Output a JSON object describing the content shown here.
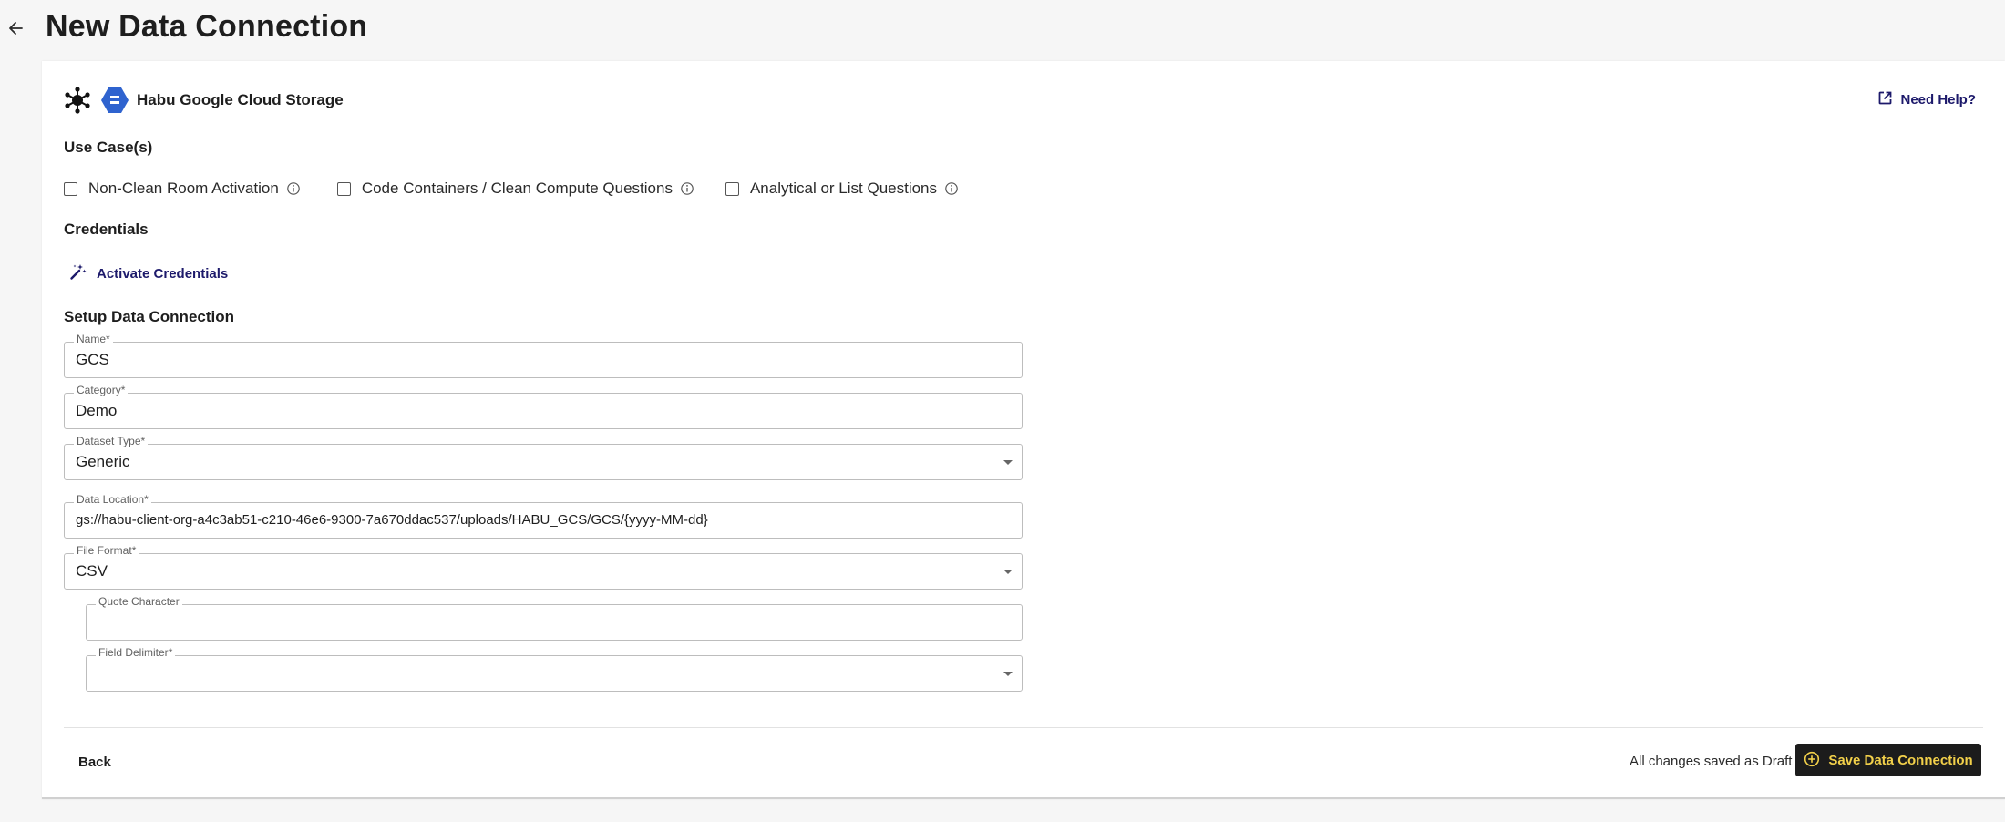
{
  "header": {
    "back_icon": "arrow-left-icon",
    "title": "New Data Connection"
  },
  "provider": {
    "icon_a": "habu-network-icon",
    "icon_b": "gcs-hexagon-icon",
    "name": "Habu Google Cloud Storage",
    "brand_color": "#2f63cf"
  },
  "help": {
    "icon": "external-link-icon",
    "label": "Need Help?"
  },
  "use_cases": {
    "title": "Use Case(s)",
    "items": [
      {
        "label": "Non-Clean Room Activation",
        "checked": false
      },
      {
        "label": "Code Containers / Clean Compute Questions",
        "checked": false
      },
      {
        "label": "Analytical or List Questions",
        "checked": false
      }
    ]
  },
  "credentials": {
    "title": "Credentials",
    "activate_icon": "magic-wand-icon",
    "activate_label": "Activate Credentials"
  },
  "setup": {
    "title": "Setup Data Connection",
    "fields": {
      "name": {
        "label": "Name",
        "value": "GCS"
      },
      "category": {
        "label": "Category",
        "value": "Demo"
      },
      "dataset_type": {
        "label": "Dataset Type",
        "value": "Generic"
      },
      "data_location": {
        "label": "Data Location",
        "value": "gs://habu-client-org-a4c3ab51-c210-46e6-9300-7a670ddac537/uploads/HABU_GCS/GCS/{yyyy-MM-dd}"
      },
      "file_format": {
        "label": "File Format",
        "value": "CSV"
      },
      "quote_character": {
        "label": "Quote Character",
        "value": ""
      },
      "field_delimiter": {
        "label": "Field Delimiter",
        "value": ""
      }
    },
    "required_marker": "*"
  },
  "footer": {
    "back_label": "Back",
    "draft_status": "All changes saved as Draft",
    "save_icon": "plus-circle-icon",
    "save_label": "Save Data Connection",
    "save_text_color": "#f2d04a",
    "link_color": "#1d1a6b"
  }
}
